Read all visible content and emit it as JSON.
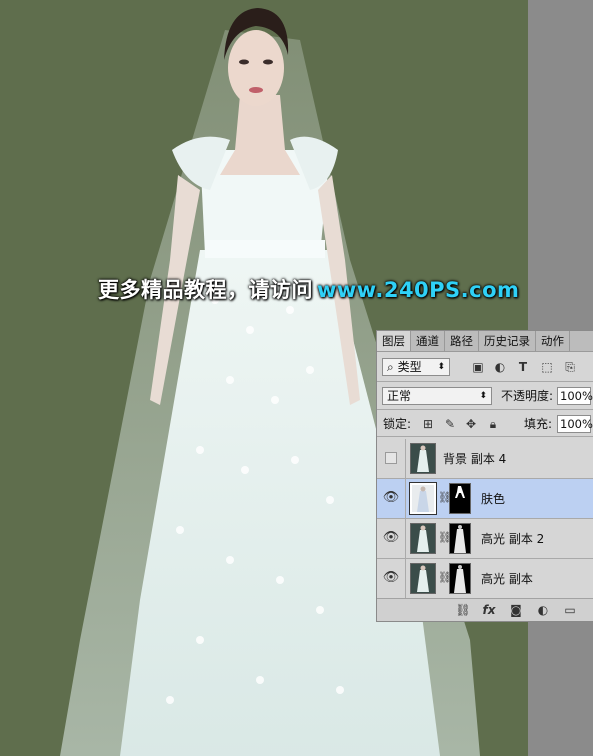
{
  "watermark": {
    "cn": "更多精品教程，请访问",
    "url": "www.240PS.com"
  },
  "colors": {
    "canvas_bg": "#5f6e4d",
    "side_strip": "#8b8b8b",
    "panel_bg": "#d6d6d6",
    "selected_row": "#bcd0f2",
    "watermark_url": "#2fd1f7"
  },
  "panel": {
    "tabs": [
      "图层",
      "通道",
      "路径",
      "历史记录",
      "动作"
    ],
    "filter": {
      "search_icon": "magnifier-icon",
      "kind_label": "类型",
      "icons": [
        "image-filter-icon",
        "adjustment-filter-icon",
        "type-filter-icon",
        "shape-filter-icon",
        "smart-object-filter-icon"
      ]
    },
    "blend_mode": "正常",
    "opacity_label": "不透明度:",
    "opacity_value": "100%",
    "lock_label": "锁定:",
    "lock_icons": [
      "lock-transparent-icon",
      "lock-paint-icon",
      "lock-position-icon",
      "lock-all-icon"
    ],
    "fill_label": "填充:",
    "fill_value": "100%",
    "layers": [
      {
        "name": "背景 副本 4",
        "visible": false,
        "selected": false,
        "has_mask": false
      },
      {
        "name": "肤色",
        "visible": true,
        "selected": true,
        "has_mask": true
      },
      {
        "name": "高光 副本 2",
        "visible": true,
        "selected": false,
        "has_mask": true
      },
      {
        "name": "高光 副本",
        "visible": true,
        "selected": false,
        "has_mask": true
      }
    ],
    "bottom_icons": [
      "link-layers-icon",
      "fx-icon",
      "add-mask-icon",
      "adjustment-layer-icon",
      "new-group-icon"
    ],
    "fx_label": "fx"
  }
}
